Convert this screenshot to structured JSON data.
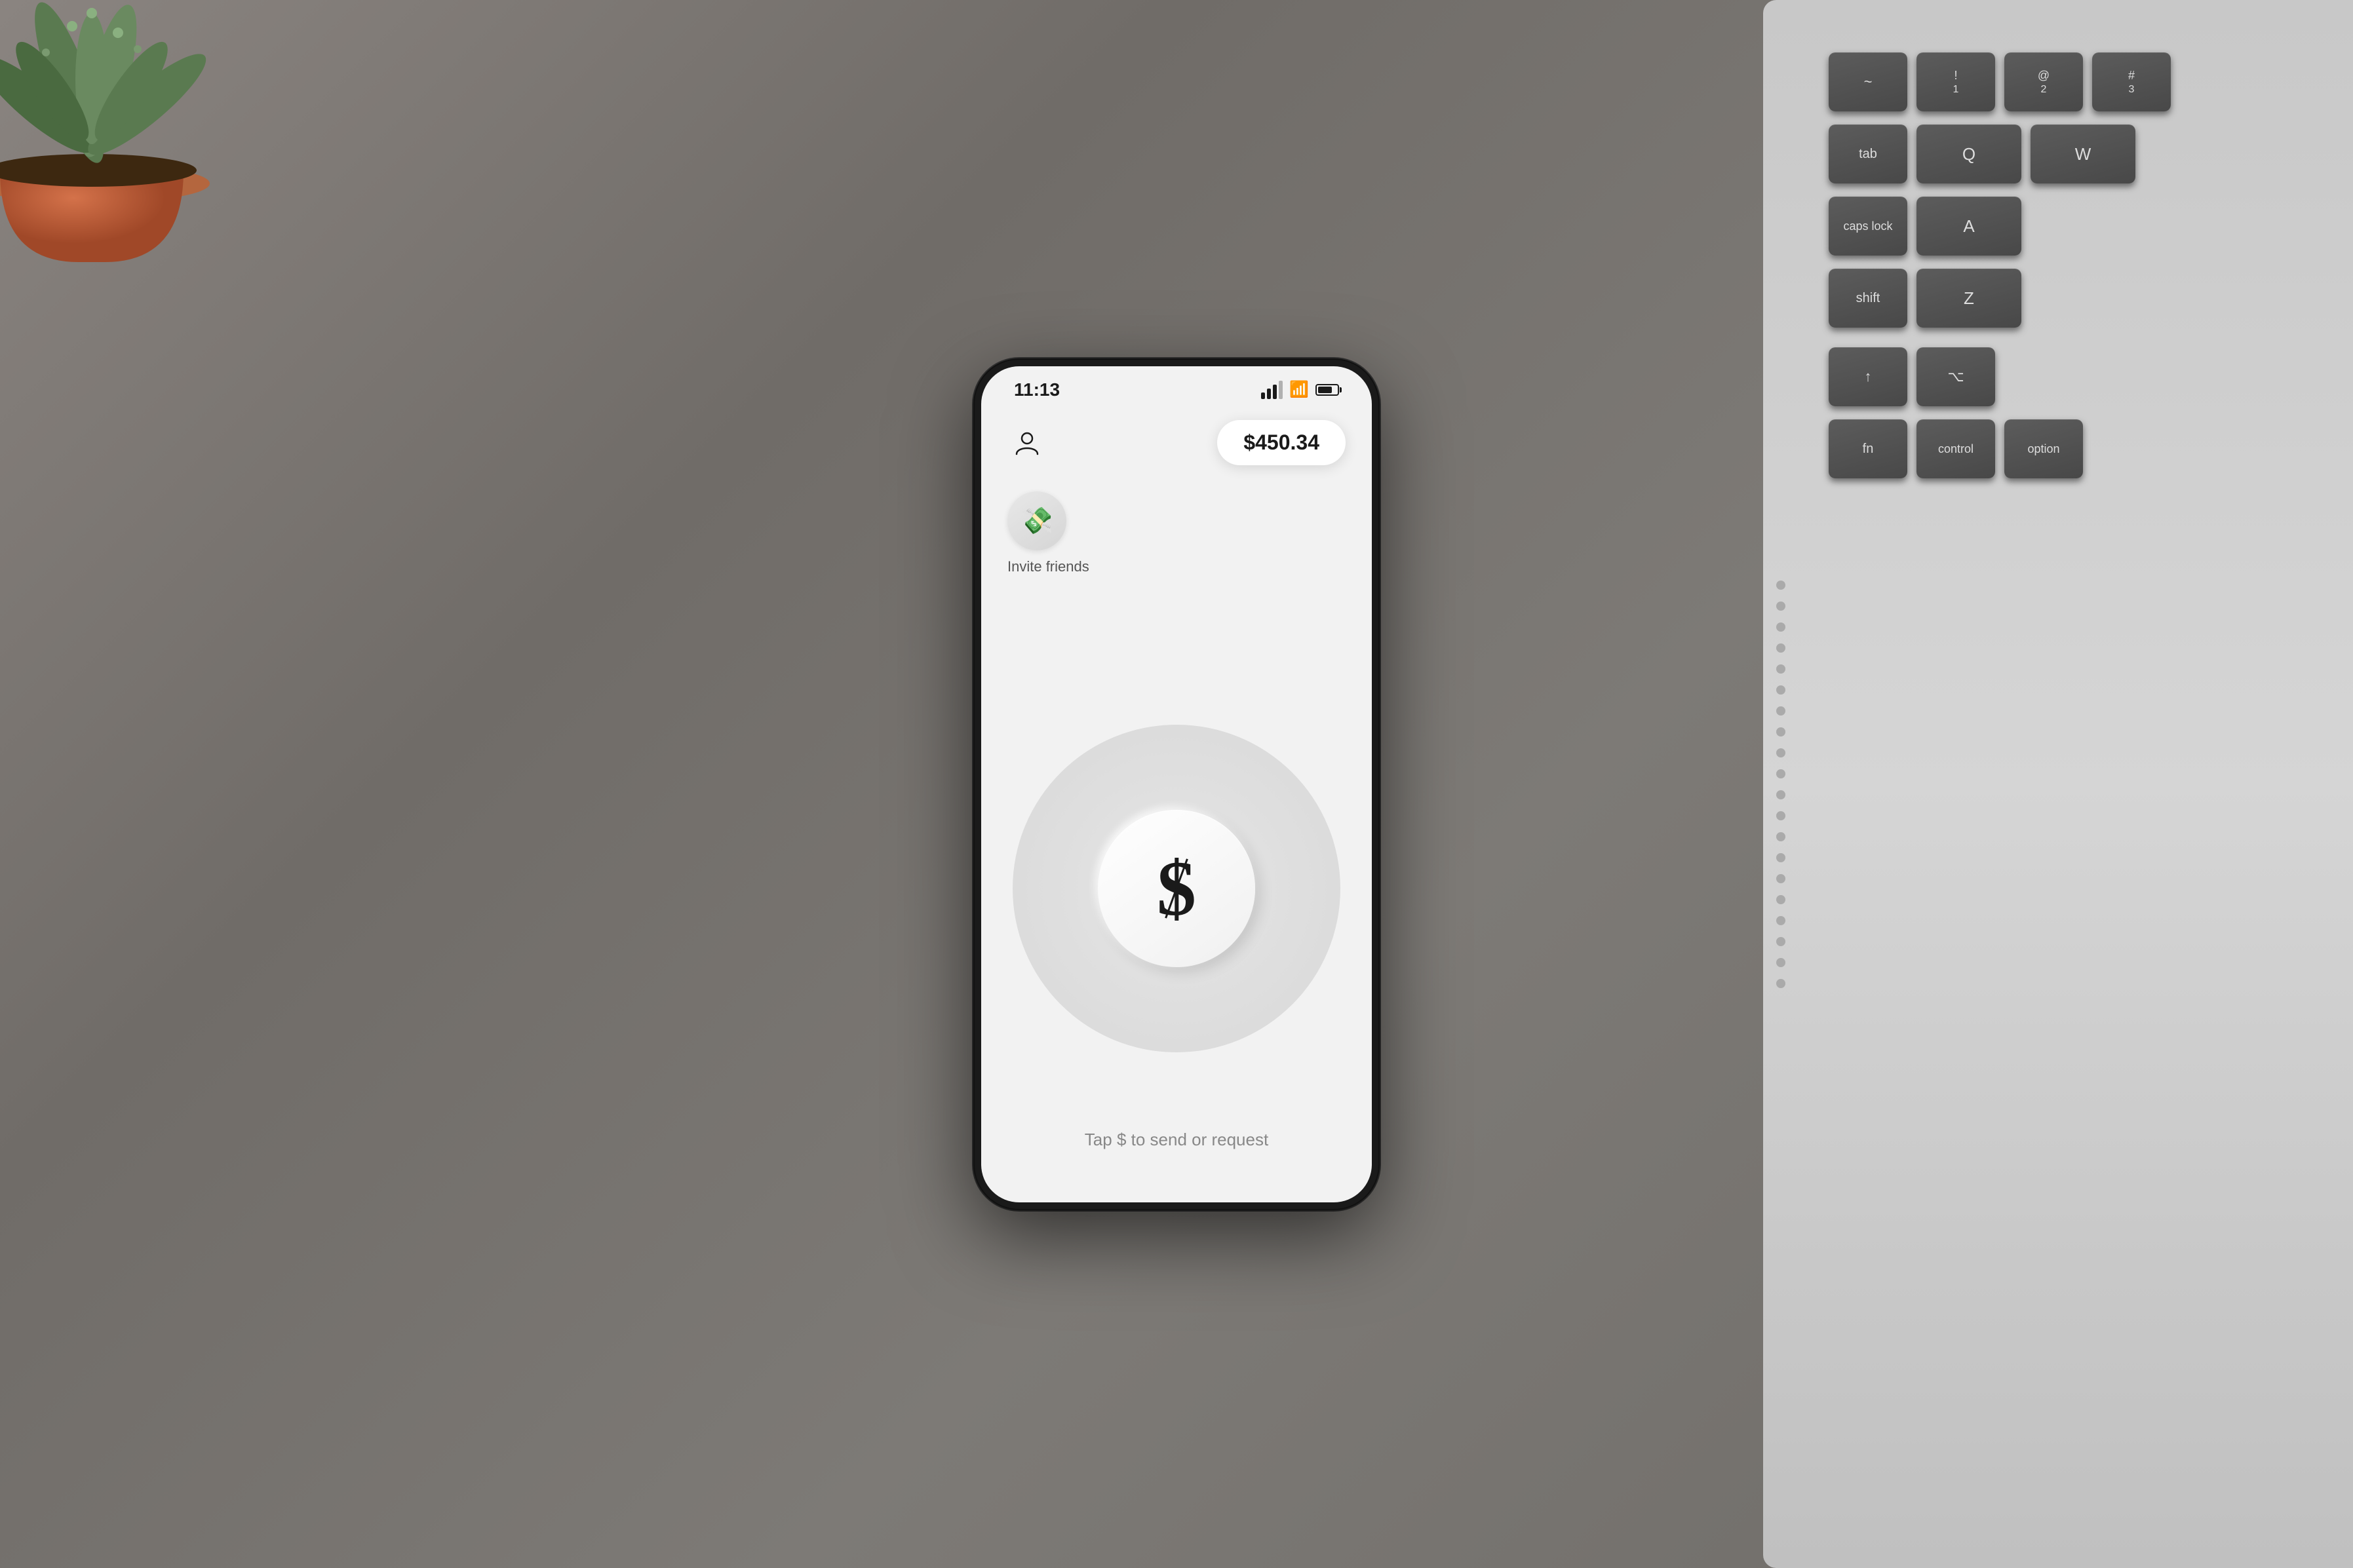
{
  "background": {
    "color": "#7a7672"
  },
  "phone": {
    "status_bar": {
      "time": "11:13",
      "signal": "medium",
      "wifi": true,
      "battery": "75%"
    },
    "balance": {
      "amount": "$450.34"
    },
    "invite": {
      "label": "Invite friends",
      "emoji": "💸"
    },
    "dollar_button": {
      "symbol": "$"
    },
    "tap_instruction": "Tap $ to send or request"
  },
  "keyboard": {
    "rows": [
      [
        "~",
        "!",
        "@"
      ],
      [
        "tab",
        "Q",
        "W"
      ],
      [
        "caps lock",
        "A"
      ],
      [
        "shift",
        "Z"
      ],
      [
        "fn",
        "control",
        "option"
      ]
    ]
  },
  "detected_text": {
    "option_key": "option"
  }
}
